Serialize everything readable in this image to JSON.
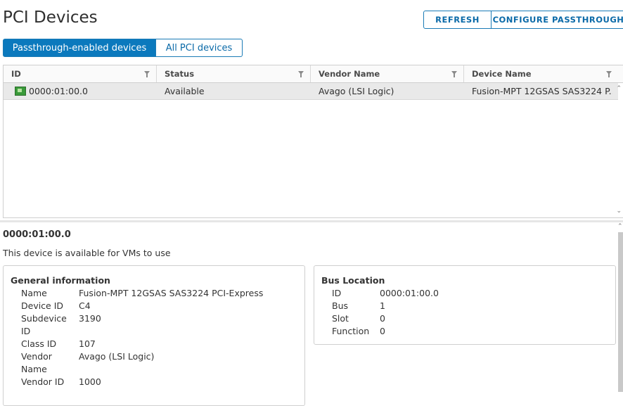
{
  "page": {
    "title": "PCI Devices"
  },
  "toolbar": {
    "refresh_label": "REFRESH",
    "configure_label": "CONFIGURE PASSTHROUGH"
  },
  "tabs": [
    {
      "label": "Passthrough-enabled devices",
      "active": true
    },
    {
      "label": "All PCI devices",
      "active": false
    }
  ],
  "grid": {
    "columns": [
      "ID",
      "Status",
      "Vendor Name",
      "Device Name"
    ],
    "rows": [
      {
        "id": "0000:01:00.0",
        "status": "Available",
        "vendor": "Avago (LSI Logic)",
        "device": "Fusion-MPT 12GSAS SAS3224 P..."
      }
    ]
  },
  "detail": {
    "title": "0000:01:00.0",
    "description": "This device is available for VMs to use",
    "general": {
      "title": "General information",
      "fields": [
        {
          "label": "Name",
          "value": "Fusion-MPT 12GSAS SAS3224 PCI-Express"
        },
        {
          "label": "Device ID",
          "value": "C4"
        },
        {
          "label": "Subdevice ID",
          "value": "3190"
        },
        {
          "label": "Class ID",
          "value": "107"
        },
        {
          "label": "Vendor Name",
          "value": "Avago (LSI Logic)"
        },
        {
          "label": "Vendor ID",
          "value": "1000"
        }
      ]
    },
    "bus": {
      "title": "Bus Location",
      "fields": [
        {
          "label": "ID",
          "value": "0000:01:00.0"
        },
        {
          "label": "Bus",
          "value": "1"
        },
        {
          "label": "Slot",
          "value": "0"
        },
        {
          "label": "Function",
          "value": "0"
        }
      ]
    }
  },
  "colors": {
    "accent": "#0b79bd",
    "row_selected": "#e9e9e9",
    "icon_green": "#3a9a3a"
  }
}
